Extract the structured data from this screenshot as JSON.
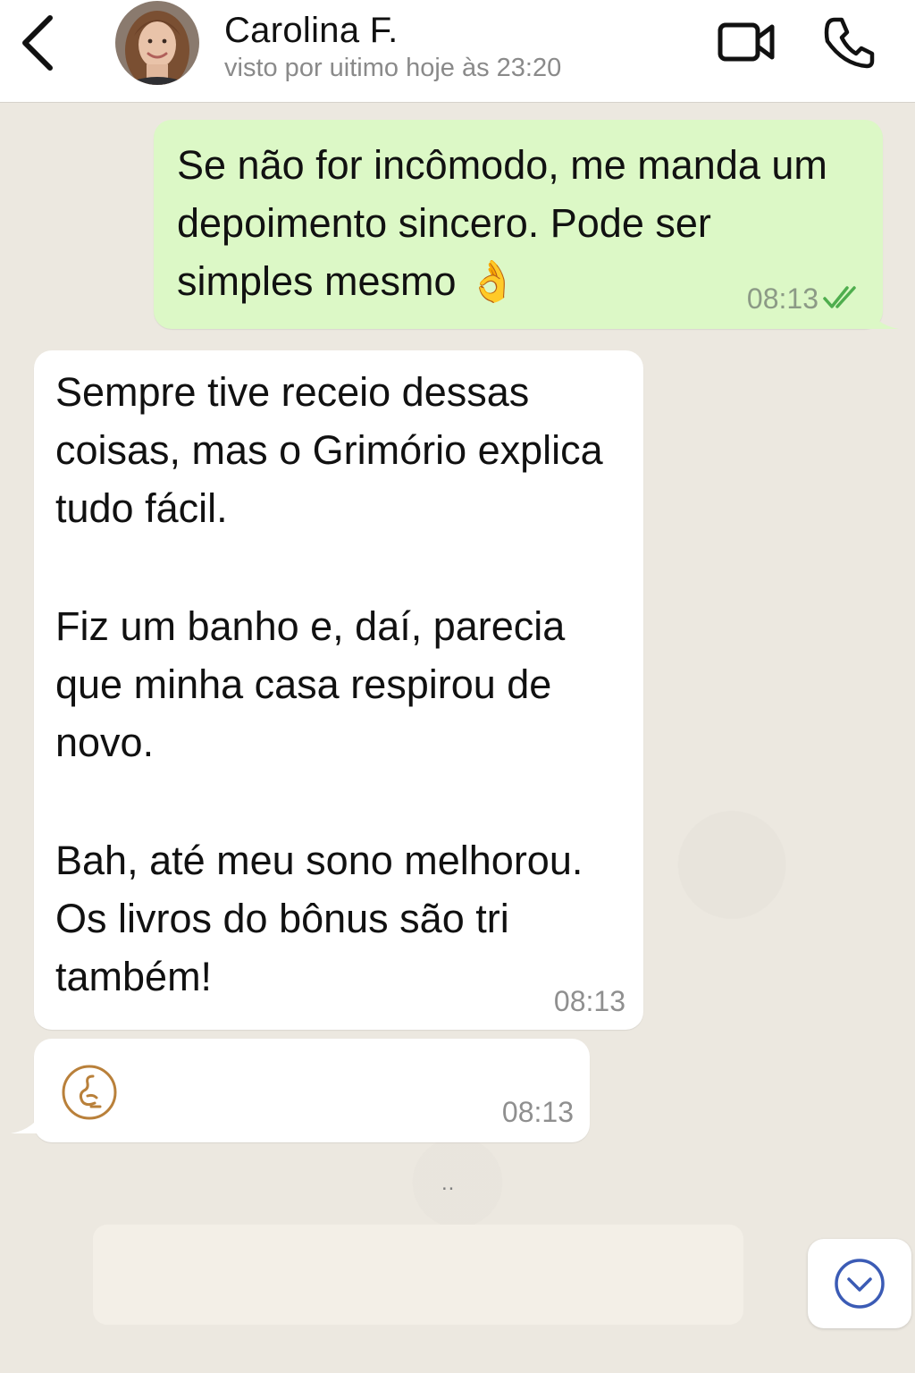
{
  "header": {
    "contact_name": "Carolina F.",
    "last_seen": "visto por uitimo hoje às 23:20",
    "icons": [
      "chevron-left-icon",
      "avatar",
      "video-camera-icon",
      "phone-icon"
    ]
  },
  "messages": [
    {
      "direction": "outgoing",
      "text": "Se não for incômodo, me manda um depoimento sincero. Pode ser simples mesmo 👌",
      "time": "08:13",
      "status": "read"
    },
    {
      "direction": "incoming",
      "paragraphs": [
        "Sempre tive receio dessas coisas, mas o Grimório explica tudo fácil.",
        "Fiz um banho e, daí, parecia que minha casa respirou de novo.",
        "Bah, até meu sono melhorou. Os livros do bônus são tri também!"
      ],
      "time": "08:13"
    },
    {
      "direction": "incoming",
      "type": "audio",
      "time": "08:13"
    }
  ],
  "typing_indicator": "..",
  "colors": {
    "outgoing_bubble": "#dcf8c6",
    "incoming_bubble": "#ffffff",
    "background": "#ece8e0",
    "read_ticks": "#4fae4e",
    "scroll_button_icon": "#3b5bb5"
  }
}
